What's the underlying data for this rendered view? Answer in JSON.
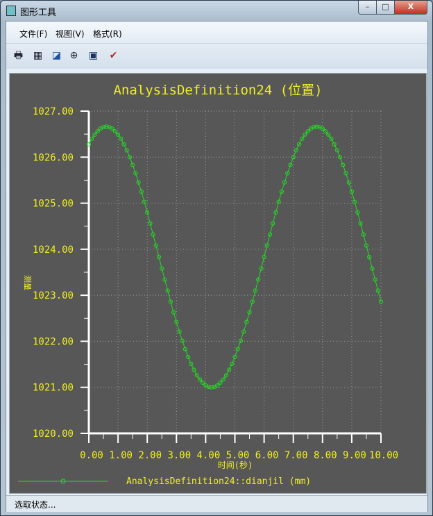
{
  "window": {
    "title": "图形工具",
    "minimize": "–",
    "maximize": "□",
    "close": "X"
  },
  "menu": [
    "文件(F)",
    "视图(V)",
    "格式(R)"
  ],
  "toolbar": [
    {
      "icon": "print-icon",
      "glyph": "🖶"
    },
    {
      "icon": "grid-view-icon",
      "glyph": "▦"
    },
    {
      "icon": "edit-chart-icon",
      "glyph": "◪"
    },
    {
      "icon": "zoom-in-icon",
      "glyph": "⊕"
    },
    {
      "icon": "zoom-fit-icon",
      "glyph": "▣"
    },
    {
      "icon": "export-icon",
      "glyph": "✔"
    }
  ],
  "status": "选取状态...",
  "colors": {
    "background": "#575757",
    "series": "#22dd22",
    "text": "#f0f020",
    "axis": "#ffffff"
  },
  "chart_data": {
    "type": "line",
    "title": "AnalysisDefinition24 (位置)",
    "xlabel": "时间(秒)",
    "ylabel": "测量",
    "xlim": [
      0,
      10
    ],
    "ylim": [
      1020,
      1027
    ],
    "grid": true,
    "legend_position": "bottom",
    "xticks": [
      "0.00",
      "1.00",
      "2.00",
      "3.00",
      "4.00",
      "5.00",
      "6.00",
      "7.00",
      "8.00",
      "9.00",
      "10.00"
    ],
    "yticks": [
      "1020.00",
      "1021.00",
      "1022.00",
      "1023.00",
      "1024.00",
      "1025.00",
      "1026.00",
      "1027.00"
    ],
    "series": [
      {
        "name": "AnalysisDefinition24::dianjil (mm)",
        "x_start": 0,
        "x_step": 0.1,
        "values": [
          1026.28,
          1026.4,
          1026.49,
          1026.56,
          1026.62,
          1026.65,
          1026.66,
          1026.65,
          1026.62,
          1026.56,
          1026.49,
          1026.4,
          1026.28,
          1026.15,
          1026.0,
          1025.83,
          1025.65,
          1025.45,
          1025.25,
          1025.03,
          1024.8,
          1024.56,
          1024.32,
          1024.08,
          1023.83,
          1023.58,
          1023.34,
          1023.1,
          1022.86,
          1022.63,
          1022.42,
          1022.21,
          1022.01,
          1021.83,
          1021.66,
          1021.51,
          1021.38,
          1021.26,
          1021.17,
          1021.1,
          1021.04,
          1021.01,
          1021.0,
          1021.01,
          1021.04,
          1021.1,
          1021.17,
          1021.26,
          1021.38,
          1021.51,
          1021.66,
          1021.83,
          1022.01,
          1022.21,
          1022.42,
          1022.63,
          1022.86,
          1023.1,
          1023.34,
          1023.58,
          1023.83,
          1024.08,
          1024.32,
          1024.56,
          1024.8,
          1025.03,
          1025.25,
          1025.45,
          1025.65,
          1025.83,
          1026.0,
          1026.15,
          1026.28,
          1026.4,
          1026.49,
          1026.56,
          1026.62,
          1026.65,
          1026.66,
          1026.65,
          1026.62,
          1026.56,
          1026.49,
          1026.4,
          1026.28,
          1026.15,
          1026.0,
          1025.83,
          1025.65,
          1025.45,
          1025.25,
          1025.03,
          1024.8,
          1024.56,
          1024.32,
          1024.08,
          1023.83,
          1023.58,
          1023.34,
          1023.1,
          1022.86
        ]
      }
    ]
  }
}
